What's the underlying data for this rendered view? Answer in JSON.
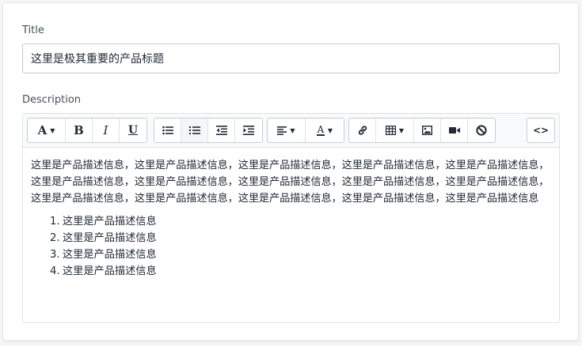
{
  "title_field": {
    "label": "Title",
    "value": "这里是极其重要的产品标题"
  },
  "description_field": {
    "label": "Description"
  },
  "toolbar": {
    "font_button": "A",
    "bold_button": "B",
    "italic_button": "I",
    "underline_button": "U",
    "font_color_button": "A",
    "code_view_button": "<>",
    "icons": [
      "font-icon",
      "bold-icon",
      "italic-icon",
      "underline-icon",
      "unordered-list-icon",
      "ordered-list-icon",
      "outdent-icon",
      "indent-icon",
      "align-left-icon",
      "font-color-icon",
      "link-icon",
      "table-icon",
      "image-icon",
      "video-icon",
      "clear-format-icon",
      "code-view-icon"
    ],
    "active": "ordered-list-icon"
  },
  "content": {
    "paragraph": "这里是产品描述信息，这里是产品描述信息，这里是产品描述信息，这里是产品描述信息，这里是产品描述信息，这里是产品描述信息，这里是产品描述信息，这里是产品描述信息，这里是产品描述信息，这里是产品描述信息，这里是产品描述信息，这里是产品描述信息，这里是产品描述信息，这里是产品描述信息，这里是产品描述信息",
    "list": [
      {
        "num": "1.",
        "text": "这里是产品描述信息"
      },
      {
        "num": "2.",
        "text": "这里是产品描述信息"
      },
      {
        "num": "3.",
        "text": "这里是产品描述信息"
      },
      {
        "num": "4.",
        "text": "这里是产品描述信息"
      }
    ]
  }
}
